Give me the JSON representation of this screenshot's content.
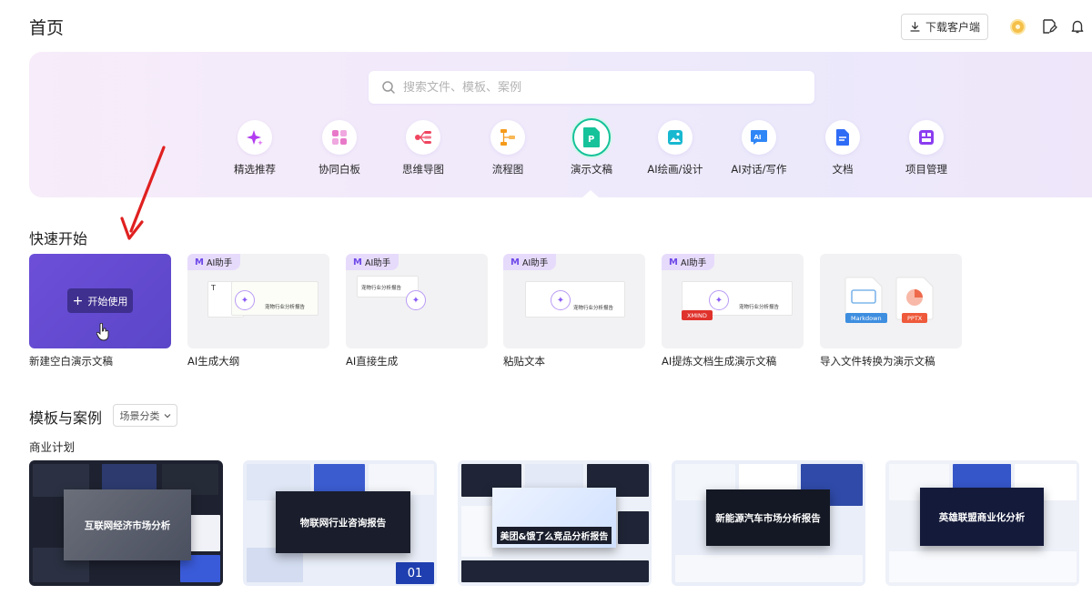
{
  "header": {
    "title": "首页",
    "download_label": "下载客户端"
  },
  "search": {
    "placeholder": "搜索文件、模板、案例"
  },
  "categories": [
    {
      "label": "精选推荐",
      "icon": "sparkle-icon",
      "color": "#b23cf0"
    },
    {
      "label": "协同白板",
      "icon": "whiteboard-icon",
      "color": "#e879c9"
    },
    {
      "label": "思维导图",
      "icon": "mindmap-icon",
      "color": "#f0455f"
    },
    {
      "label": "流程图",
      "icon": "flowchart-icon",
      "color": "#f59a1b"
    },
    {
      "label": "演示文稿",
      "icon": "presentation-icon",
      "color": "#16c29a",
      "active": true
    },
    {
      "label": "AI绘画/设计",
      "icon": "ai-paint-icon",
      "color": "#18b8d0"
    },
    {
      "label": "AI对话/写作",
      "icon": "ai-chat-icon",
      "color": "#2f86f6"
    },
    {
      "label": "文档",
      "icon": "document-icon",
      "color": "#2f6cf6"
    },
    {
      "label": "项目管理",
      "icon": "project-icon",
      "color": "#8b3df0"
    }
  ],
  "quick_start": {
    "title": "快速开始",
    "start_button": "开始使用",
    "ai_badge": "AI助手",
    "mini_doc_title": "宠物行业分析报告",
    "xmind_chip": "XMIND",
    "markdown_chip": "Markdown",
    "pptx_chip": "PPTX",
    "cards": [
      {
        "label": "新建空白演示文稿"
      },
      {
        "label": "AI生成大纲"
      },
      {
        "label": "AI直接生成"
      },
      {
        "label": "粘贴文本"
      },
      {
        "label": "AI提炼文档生成演示文稿"
      },
      {
        "label": "导入文件转换为演示文稿"
      }
    ]
  },
  "templates": {
    "title": "模板与案例",
    "filter_label": "场景分类",
    "group_title": "商业计划",
    "items": [
      {
        "title": "互联网经济市场分析"
      },
      {
        "title": "物联网行业咨询报告",
        "page": "01"
      },
      {
        "title": "美团&饿了么竞品分析报告"
      },
      {
        "title": "新能源汽车市场分析报告"
      },
      {
        "title": "英雄联盟商业化分析"
      }
    ]
  },
  "colors": {
    "accent_purple": "#6d4fd8",
    "active_green": "#16c29a",
    "banner_bg": "#f1eafb",
    "arrow_red": "#e02020"
  }
}
